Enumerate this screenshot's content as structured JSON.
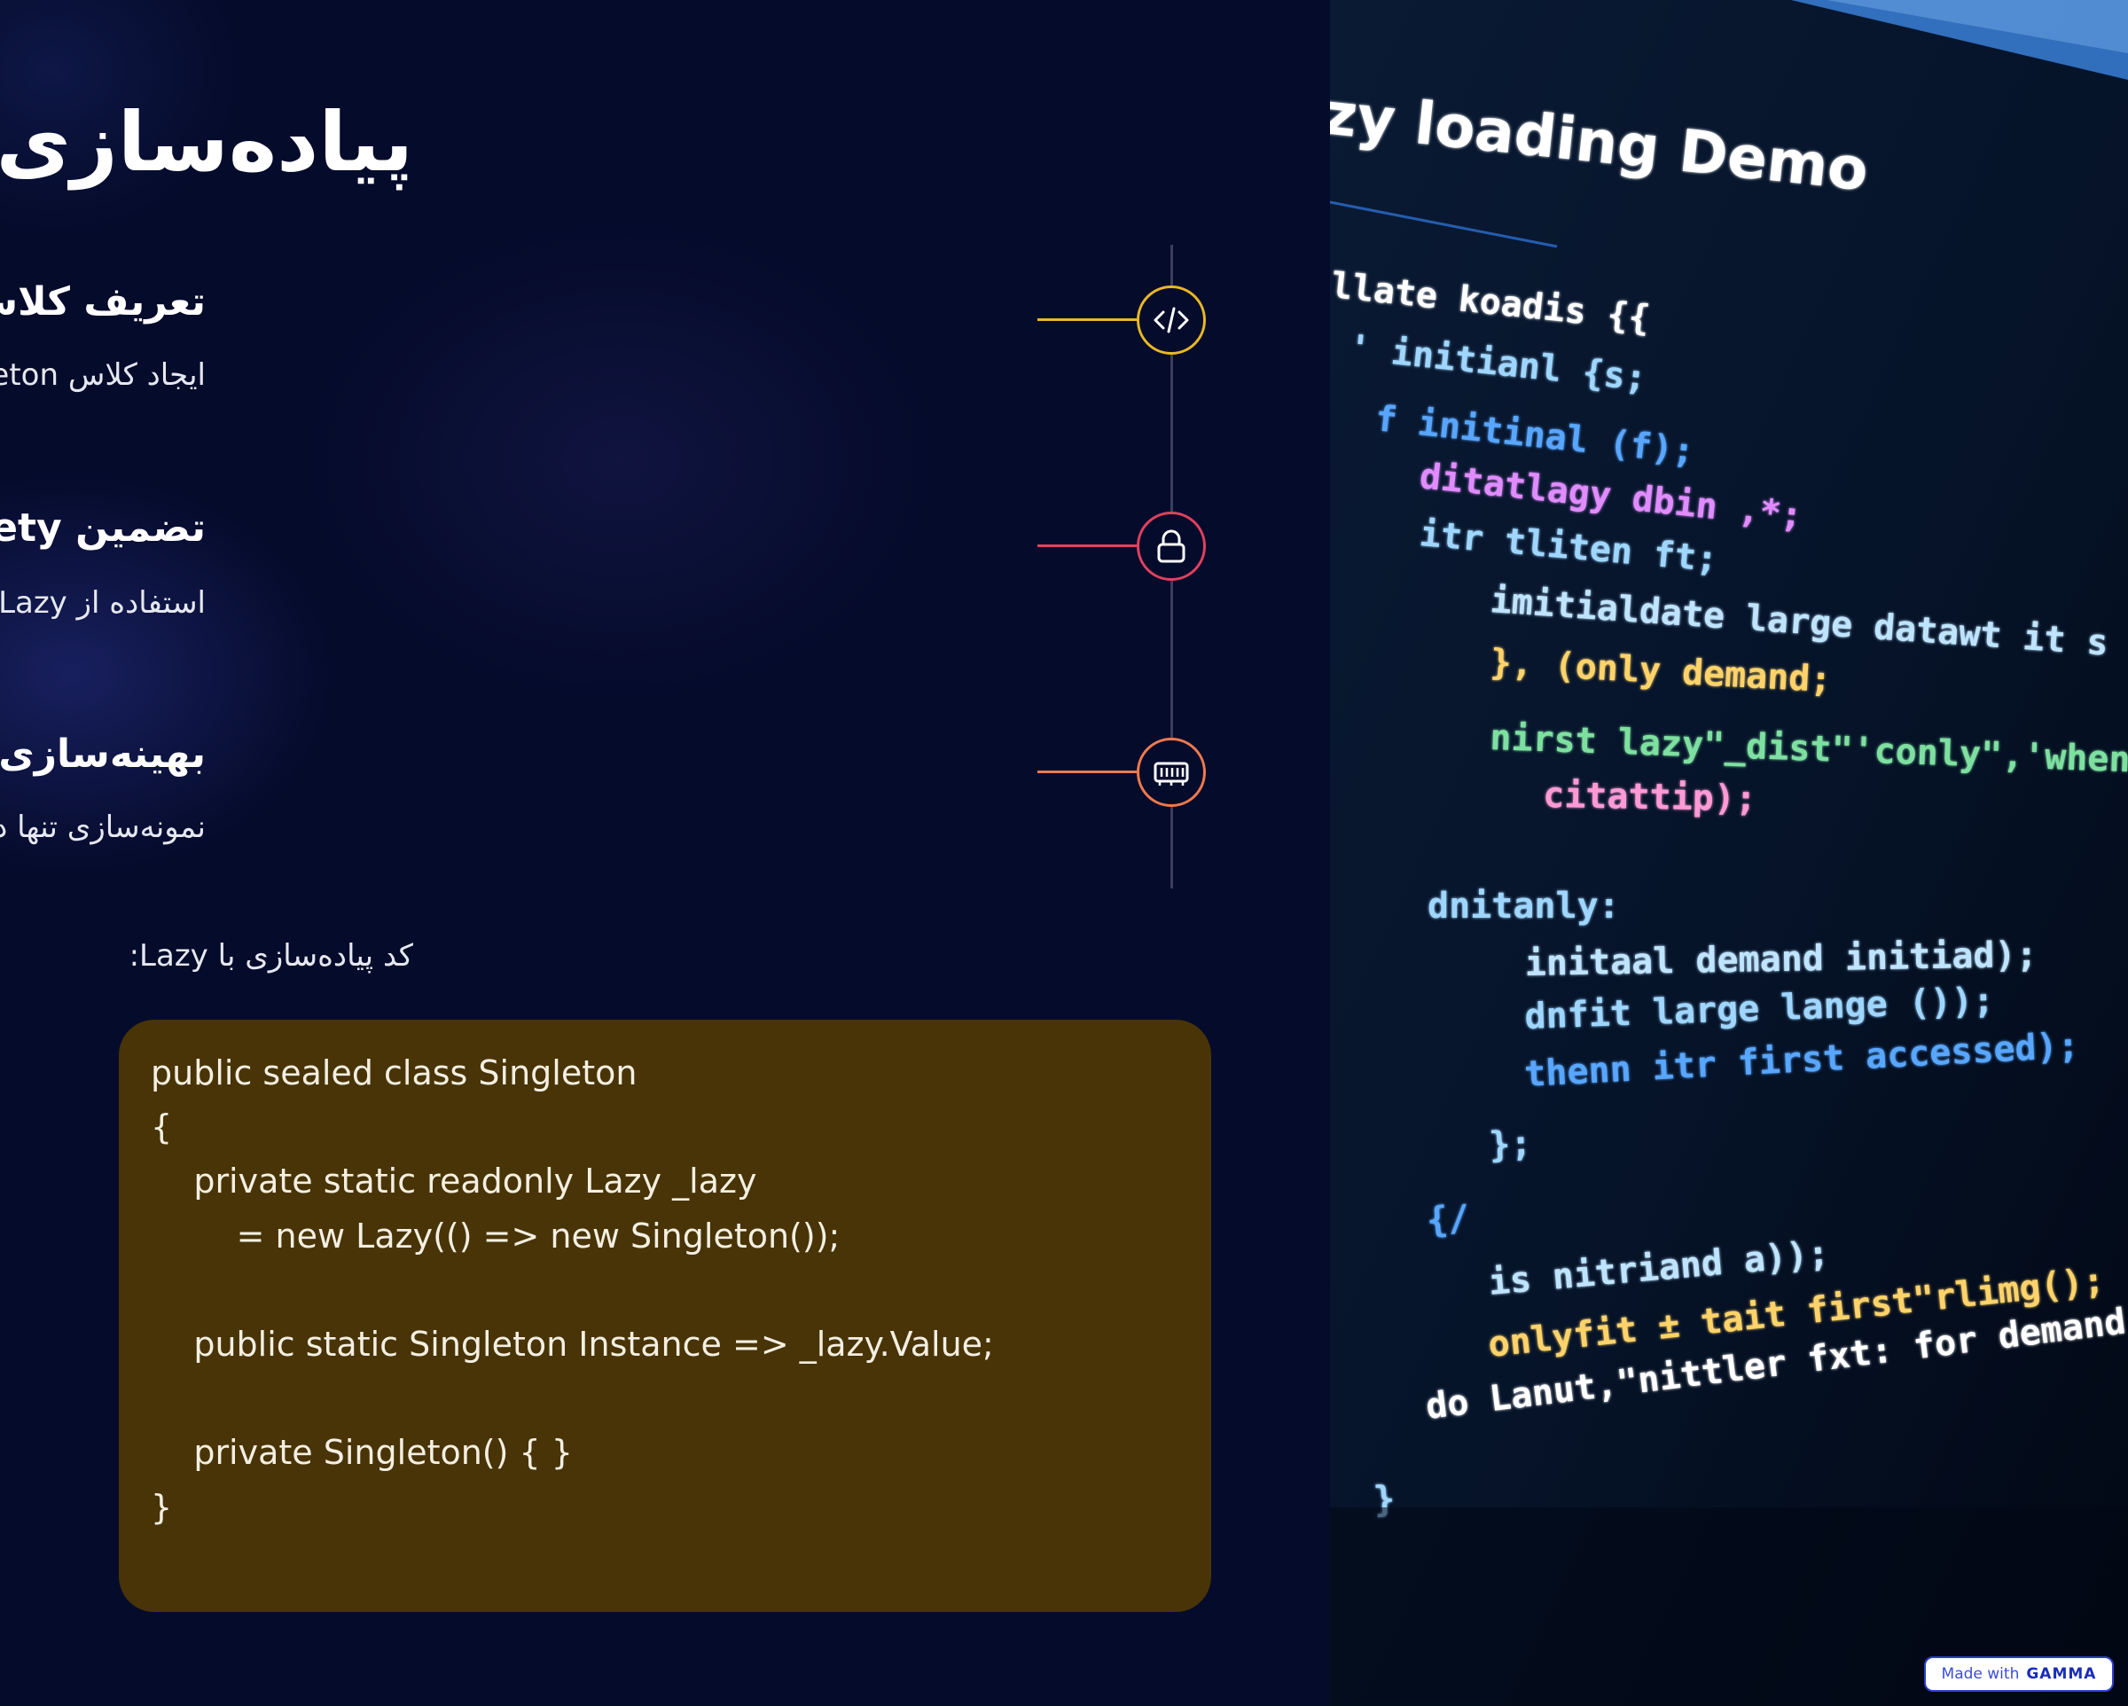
{
  "slide": {
    "title": "پیاده‌سازی با Lazy Initialization",
    "steps": [
      {
        "title": "تعریف کلاس",
        "description": "ایجاد کلاس Singleton با فیلد Lazy برای تأخیر در نمونه‌سازی",
        "icon": "code-icon",
        "color": "#e9b824"
      },
      {
        "title": "تضمین Thread-safety",
        "description": "استفاده از Lazy برای اطمینان از ایمنی در محیط‌های چندنخی",
        "icon": "lock-icon",
        "color": "#e0415e"
      },
      {
        "title": "بهینه‌سازی حافظه",
        "description": "نمونه‌سازی تنها در زمان اولین درخواست انجام می‌شود",
        "icon": "memory-icon",
        "color": "#ef7a4d"
      }
    ],
    "code_caption": "کد پیاده‌سازی با Lazy:",
    "code_lines": [
      "public sealed class Singleton",
      "{",
      "    private static readonly Lazy _lazy",
      "        = new Lazy(() => new Singleton());",
      "",
      "    public static Singleton Instance => _lazy.Value;",
      "",
      "    private Singleton() { }",
      "}"
    ],
    "code_bg": "#483406"
  },
  "image": {
    "heading": "zy loading Demo",
    "lines": [
      {
        "text": "llate koadis {{",
        "color": "#ffffff"
      },
      {
        "text": "' initianl {s;",
        "color": "#9fd6ff"
      },
      {
        "text": "f initinal (f);",
        "color": "#58a6ff"
      },
      {
        "text": "ditatlagy dbin ,*;",
        "color": "#e08cff"
      },
      {
        "text": "itr tliten ft;",
        "color": "#9fd6ff"
      },
      {
        "text": "imitialdate large datawt it s an demand;",
        "color": "#bfe4ff"
      },
      {
        "text": "}, (only demand;",
        "color": "#ffd36b"
      },
      {
        "text": "nirst lazy\"_dist\"'conly\",'when",
        "color": "#7ee0a0"
      },
      {
        "text": "citattip);",
        "color": "#ff9ad5"
      },
      {
        "text": "dnitanly:",
        "color": "#9fd6ff"
      },
      {
        "text": "initaal demand initiad);",
        "color": "#bfe4ff"
      },
      {
        "text": "dnfit large lange ());",
        "color": "#9fd6ff"
      },
      {
        "text": "thenn itr first accessed);",
        "color": "#58a6ff"
      },
      {
        "text": "};",
        "color": "#9fd6ff"
      },
      {
        "text": "{/",
        "color": "#58a6ff"
      },
      {
        "text": "is nitriand a));",
        "color": "#bfe4ff"
      },
      {
        "text": "onlyfit ± tait first\"rlimg();",
        "color": "#ffd36b"
      },
      {
        "text": "do Lanut,\"nittler fxt: for demand;",
        "color": "#ffffff"
      },
      {
        "text": "}",
        "color": "#9fd6ff"
      }
    ]
  },
  "badge": {
    "made_with": "Made with",
    "brand": "GAMMA"
  }
}
